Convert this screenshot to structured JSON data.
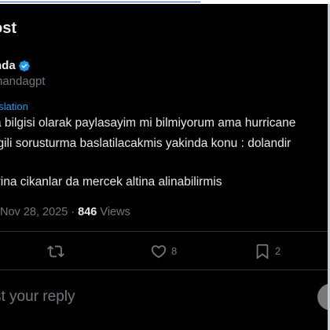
{
  "header": {
    "title": "ost"
  },
  "author": {
    "name": "nda",
    "handle": "handagpt",
    "verified": true,
    "verified_color": "#1d9bf0"
  },
  "post": {
    "translation_link": "nslation",
    "lines": [
      "a bilgisi olarak paylasayim mi bilmiyorum ama hurricane",
      "lgili sorusturma baslatilacakmis yakinda konu : dolandir",
      "yina cikanlar da mercek altina alinabilirmis"
    ],
    "date": "Nov 28, 2025",
    "separator": "·",
    "views_count": "846",
    "views_label": "Views"
  },
  "actions": {
    "repost_icon": "repost-icon",
    "like_icon": "heart-icon",
    "like_count": "8",
    "bookmark_icon": "bookmark-icon",
    "bookmark_count": "2"
  },
  "reply": {
    "placeholder": "st your reply"
  },
  "colors": {
    "background": "#000000",
    "text": "#e7e9ea",
    "secondary_text": "#71767b",
    "accent": "#1d9bf0",
    "divider": "#2f3336"
  }
}
